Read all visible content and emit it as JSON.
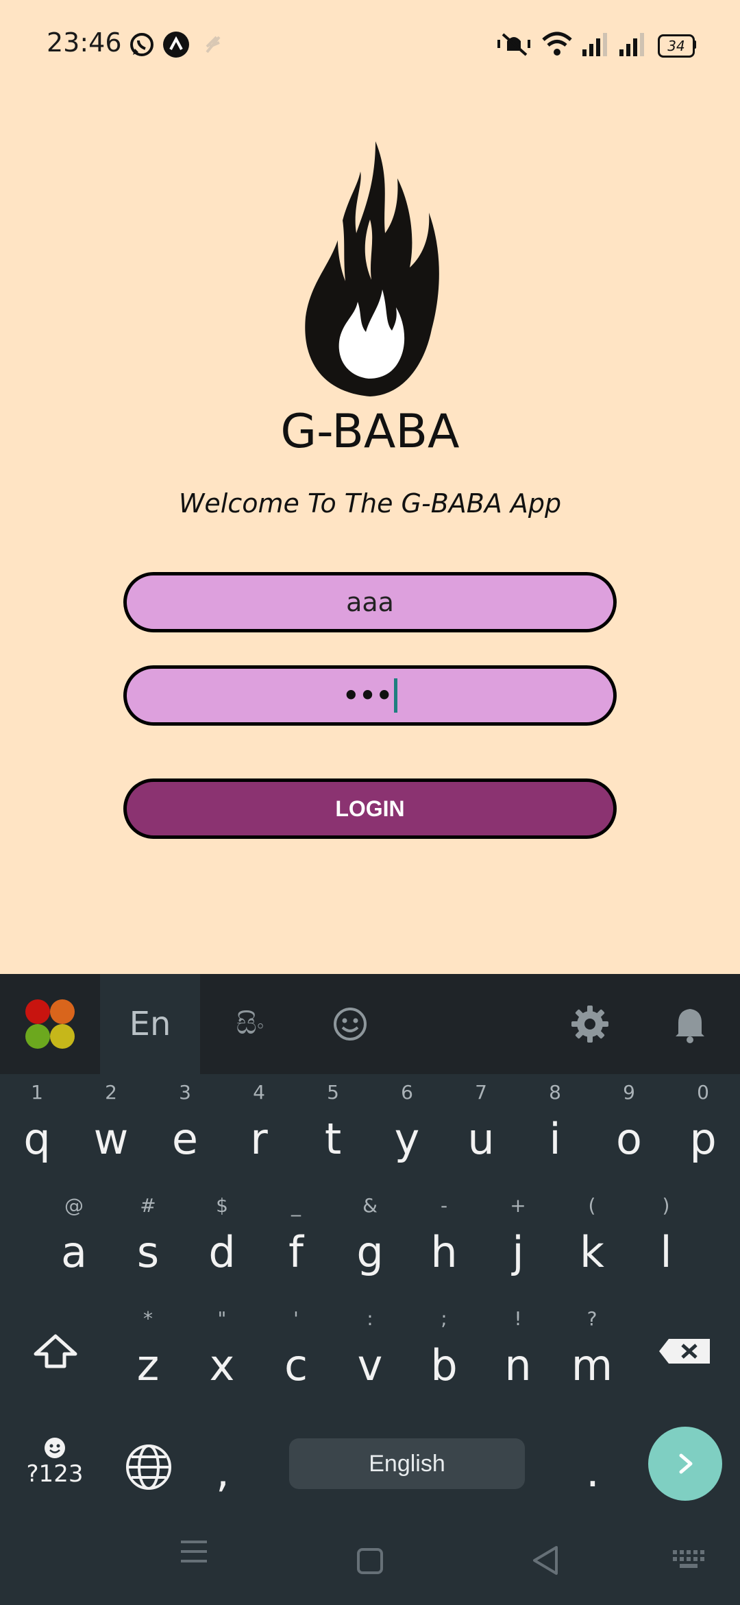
{
  "status_bar": {
    "time": "23:46",
    "battery": "34",
    "icons": [
      "whatsapp-icon",
      "app-icon",
      "sync-icon",
      "mute-icon",
      "wifi-icon",
      "signal-icon",
      "signal-icon-2",
      "battery-icon"
    ]
  },
  "app": {
    "title": "G-BABA",
    "welcome": "Welcome To The G-BABA App",
    "username_value": "aaa",
    "password_value": "•••",
    "login_label": "LOGIN",
    "colors": {
      "background": "#ffe4c4",
      "input": "#dda0dd",
      "button": "#8b3371"
    }
  },
  "keyboard": {
    "toolbar": {
      "lang_tab": "En",
      "script_tab": "සිං"
    },
    "row1": [
      {
        "hint": "1",
        "key": "q"
      },
      {
        "hint": "2",
        "key": "w"
      },
      {
        "hint": "3",
        "key": "e"
      },
      {
        "hint": "4",
        "key": "r"
      },
      {
        "hint": "5",
        "key": "t"
      },
      {
        "hint": "6",
        "key": "y"
      },
      {
        "hint": "7",
        "key": "u"
      },
      {
        "hint": "8",
        "key": "i"
      },
      {
        "hint": "9",
        "key": "o"
      },
      {
        "hint": "0",
        "key": "p"
      }
    ],
    "row2": [
      {
        "hint": "@",
        "key": "a"
      },
      {
        "hint": "#",
        "key": "s"
      },
      {
        "hint": "$",
        "key": "d"
      },
      {
        "hint": "_",
        "key": "f"
      },
      {
        "hint": "&",
        "key": "g"
      },
      {
        "hint": "-",
        "key": "h"
      },
      {
        "hint": "+",
        "key": "j"
      },
      {
        "hint": "(",
        "key": "k"
      },
      {
        "hint": ")",
        "key": "l"
      }
    ],
    "row3": [
      {
        "hint": "*",
        "key": "z"
      },
      {
        "hint": "\"",
        "key": "x"
      },
      {
        "hint": "'",
        "key": "c"
      },
      {
        "hint": ":",
        "key": "v"
      },
      {
        "hint": ";",
        "key": "b"
      },
      {
        "hint": "!",
        "key": "n"
      },
      {
        "hint": "?",
        "key": "m"
      }
    ],
    "symbols_label": "?123",
    "comma": ",",
    "period": ".",
    "space_label": "English"
  }
}
